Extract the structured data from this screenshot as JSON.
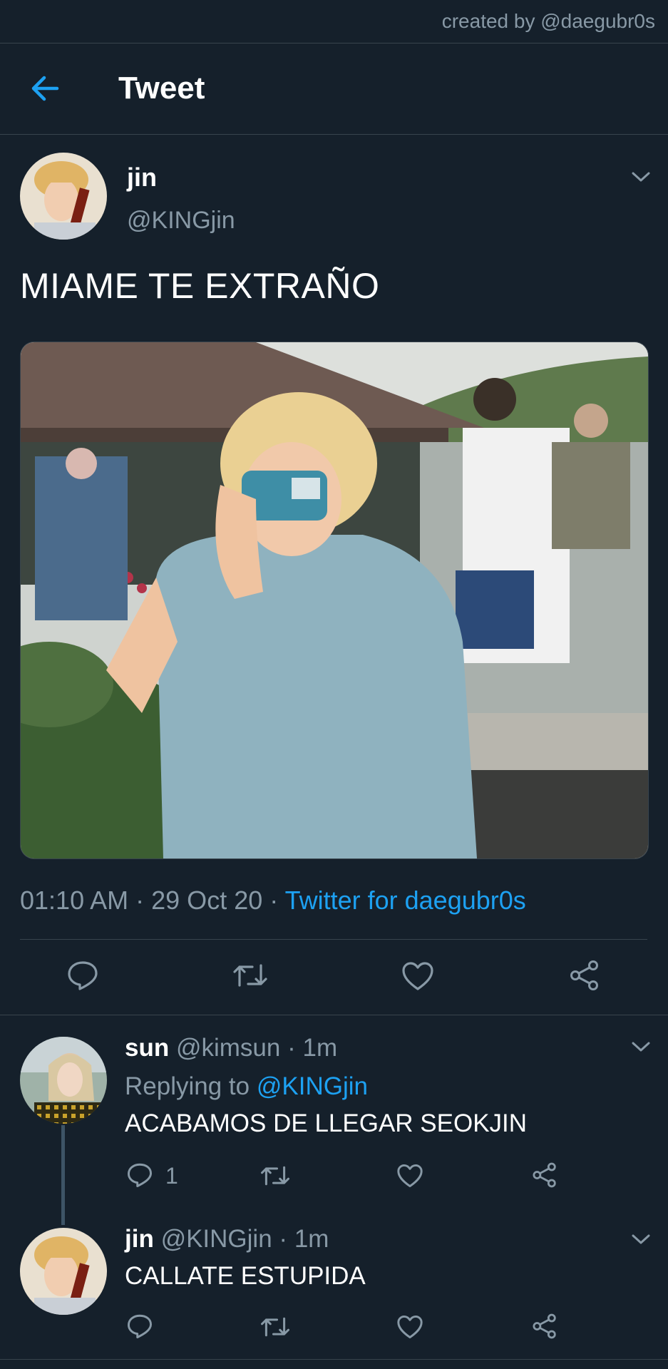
{
  "credit": "created by @daegubr0s",
  "header": {
    "title": "Tweet",
    "back_icon": "arrow-left-icon"
  },
  "tweet": {
    "display_name": "jin",
    "handle": "@KINGjin",
    "text": "MIAME TE EXTRAÑO",
    "time": "01:10 AM",
    "date": "29 Oct 20",
    "separator": "·",
    "source": "Twitter for daegubr0s",
    "actions": [
      "reply-icon",
      "retweet-icon",
      "like-icon",
      "share-icon"
    ]
  },
  "replies": [
    {
      "display_name": "sun",
      "handle": "@kimsun",
      "time": "1m",
      "separator": "·",
      "replying_prefix": "Replying to",
      "replying_to": "@KINGjin",
      "text": "ACABAMOS DE LLEGAR SEOKJIN",
      "reply_count": "1"
    },
    {
      "display_name": "jin",
      "handle": "@KINGjin",
      "time": "1m",
      "separator": "·",
      "text": "CALLATE ESTUPIDA"
    }
  ],
  "colors": {
    "background": "#15202b",
    "divider": "#38444d",
    "muted": "#8899a6",
    "accent": "#1da1f2"
  }
}
